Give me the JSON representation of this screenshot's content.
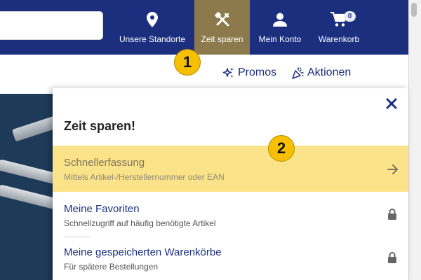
{
  "nav": {
    "search": {
      "placeholder": ""
    },
    "items": [
      {
        "label": "Unsere Standorte",
        "icon": "location-pin-icon"
      },
      {
        "label": "Zeit sparen",
        "icon": "tools-icon",
        "active": true
      },
      {
        "label": "Mein Konto",
        "icon": "user-icon"
      },
      {
        "label": "Warenkorb",
        "icon": "cart-icon",
        "badge": "0"
      }
    ]
  },
  "subnav": {
    "promos": {
      "label": "Promos",
      "icon": "sparkle-icon"
    },
    "actions": {
      "label": "Aktionen",
      "icon": "party-popper-icon"
    }
  },
  "panel": {
    "title": "Zeit sparen!",
    "close_icon": "close-icon",
    "items": [
      {
        "title": "Schnellerfassung",
        "subtitle": "Mittels Artikel-/Herstellernummer oder EAN",
        "icon": "arrow-right-icon",
        "highlighted": true
      },
      {
        "title": "Meine Favoriten",
        "subtitle": "Schnellzugriff auf häufig benötigte Artikel",
        "icon": "lock-icon"
      },
      {
        "title": "Meine gespeicherten Warenkörbe",
        "subtitle": "Für spätere Bestellungen",
        "icon": "lock-icon"
      }
    ]
  },
  "markers": [
    "1",
    "2"
  ],
  "colors": {
    "nav_bg": "#1b2f7e",
    "nav_active": "#8c7a4c",
    "highlight_row": "#fbe38a",
    "link": "#1b2f7e",
    "marker": "#f6c000"
  }
}
